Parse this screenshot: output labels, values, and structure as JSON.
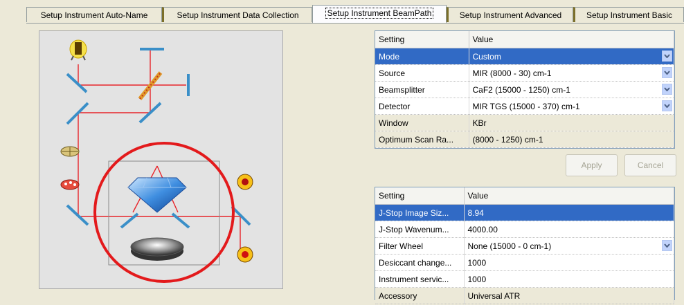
{
  "tabs": [
    {
      "label": "Setup Instrument Auto-Name"
    },
    {
      "label": "Setup Instrument Data Collection"
    },
    {
      "label": "Setup Instrument BeamPath"
    },
    {
      "label": "Setup Instrument Advanced"
    },
    {
      "label": "Setup Instrument Basic"
    }
  ],
  "active_tab": "Setup Instrument BeamPath",
  "top_grid": {
    "headers": {
      "setting": "Setting",
      "value": "Value"
    },
    "rows": [
      {
        "setting": "Mode",
        "value": "Custom",
        "dropdown": true,
        "selected": true
      },
      {
        "setting": "Source",
        "value": "MIR (8000 - 30) cm-1",
        "dropdown": true
      },
      {
        "setting": "Beamsplitter",
        "value": "CaF2 (15000 - 1250) cm-1",
        "dropdown": true
      },
      {
        "setting": "Detector",
        "value": "MIR TGS (15000 - 370) cm-1",
        "dropdown": true
      },
      {
        "setting": "Window",
        "value": "KBr",
        "readonly": true
      },
      {
        "setting": "Optimum Scan Ra...",
        "value": "(8000 - 1250) cm-1",
        "readonly": true
      }
    ]
  },
  "buttons": {
    "apply": "Apply",
    "cancel": "Cancel"
  },
  "bottom_grid": {
    "headers": {
      "setting": "Setting",
      "value": "Value"
    },
    "rows": [
      {
        "setting": "J-Stop Image Siz...",
        "value": "8.94",
        "selected": true
      },
      {
        "setting": "J-Stop Wavenum...",
        "value": "4000.00"
      },
      {
        "setting": "Filter Wheel",
        "value": "None (15000 - 0 cm-1)",
        "dropdown": true
      },
      {
        "setting": "Desiccant change...",
        "value": "1000"
      },
      {
        "setting": "Instrument servic...",
        "value": "1000"
      },
      {
        "setting": "Accessory",
        "value": "Universal ATR",
        "readonly": true
      }
    ]
  },
  "colors": {
    "beam": "#e8242a",
    "highlight_circle": "#e31a1c",
    "selection": "#316ac5",
    "mirror": "#3a8fc8"
  },
  "icons": {
    "dropdown": "chevron-down-icon",
    "source": "lamp-icon",
    "beamsplitter": "beamsplitter-icon",
    "aperture": "aperture-wheel-icon",
    "filter_wheel": "filter-wheel-icon",
    "atr_crystal": "diamond-crystal-icon",
    "atr_plate": "sample-plate-icon",
    "detector": "detector-icon"
  }
}
